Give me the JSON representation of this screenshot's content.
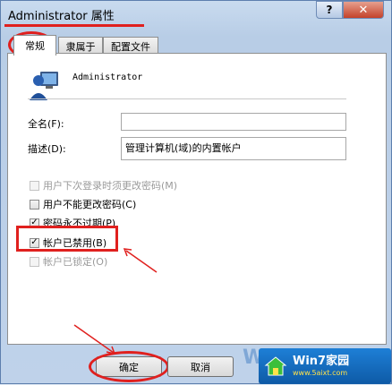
{
  "window": {
    "title": "Administrator 属性",
    "help_button": "?",
    "close_button": "✕"
  },
  "tabs": [
    {
      "label": "常规",
      "active": true
    },
    {
      "label": "隶属于",
      "active": false
    },
    {
      "label": "配置文件",
      "active": false
    }
  ],
  "general": {
    "username": "Administrator",
    "fullname_label": "全名(F):",
    "fullname_value": "",
    "description_label": "描述(D):",
    "description_value": "管理计算机(域)的内置帐户",
    "options": [
      {
        "label": "用户下次登录时须更改密码(M)",
        "checked": false,
        "enabled": false
      },
      {
        "label": "用户不能更改密码(C)",
        "checked": false,
        "enabled": true
      },
      {
        "label": "密码永不过期(P)",
        "checked": true,
        "enabled": true
      },
      {
        "label": "帐户已禁用(B)",
        "checked": true,
        "enabled": true
      },
      {
        "label": "帐户已锁定(O)",
        "checked": false,
        "enabled": false
      }
    ]
  },
  "footer": {
    "ok_label": "确定",
    "cancel_label": "取消"
  },
  "watermark": {
    "brand": "Win7家园",
    "url": "www.5aixt.com",
    "partial": "Wi"
  },
  "colors": {
    "annotation_red": "#e0201e",
    "title_bar": "#c9dbef",
    "watermark_blue": "#1e7fd6"
  }
}
